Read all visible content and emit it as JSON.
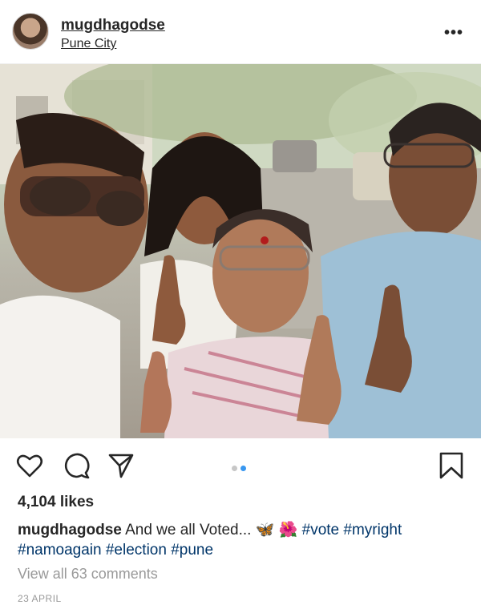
{
  "post": {
    "username": "mugdhagodse",
    "location": "Pune City",
    "more_icon": "more-icon",
    "photo_description_icon": "photo",
    "carousel": {
      "total": 2,
      "active": 1
    },
    "likes": "4,104 likes",
    "caption": {
      "username": "mugdhagodse",
      "text": "And we all Voted...",
      "emoji": "🦋 🌺",
      "hashtags_line1": "#vote #myright",
      "hashtags_line2": "#namoagain #election #pune"
    },
    "view_comments": "View all 63 comments",
    "date": "23 APRIL"
  },
  "colors": {
    "link": "#003569",
    "muted": "#999999",
    "dot_active": "#3897f0"
  }
}
